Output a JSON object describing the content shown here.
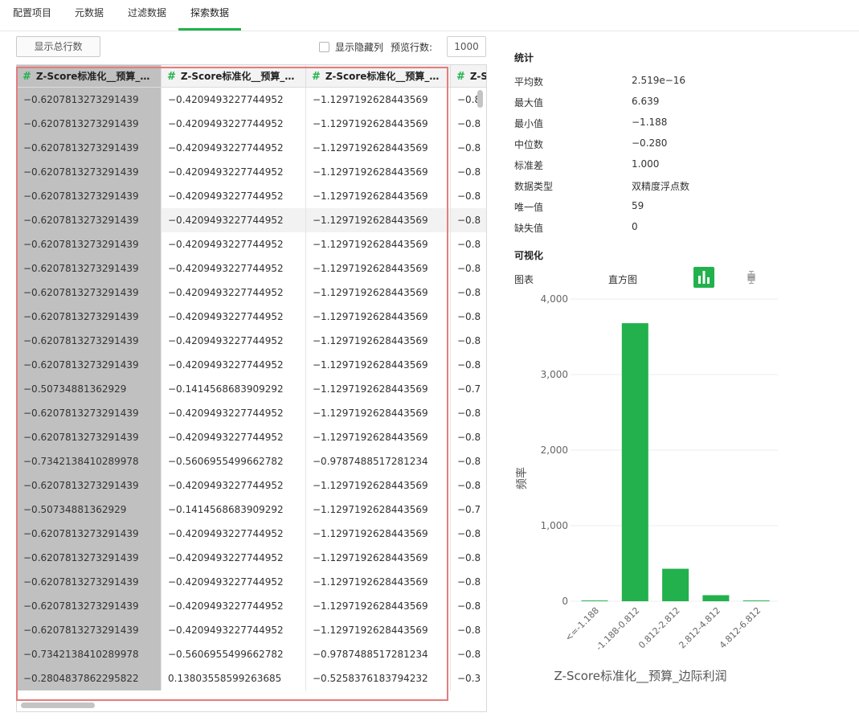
{
  "tabs": [
    {
      "label": "配置项目"
    },
    {
      "label": "元数据"
    },
    {
      "label": "过滤数据"
    },
    {
      "label": "探索数据"
    }
  ],
  "toolbar": {
    "total_rows_button": "显示总行数",
    "show_hidden_label": "显示隐藏列",
    "preview_rows_label": "预览行数:",
    "preview_rows_value": "1000"
  },
  "table": {
    "columns": [
      "Z-Score标准化__预算_…",
      "Z-Score标准化__预算_…",
      "Z-Score标准化__预算_…",
      "Z-S"
    ],
    "rows": [
      [
        "−0.6207813273291439",
        "−0.4209493227744952",
        "−1.1297192628443569",
        "−0.8"
      ],
      [
        "−0.6207813273291439",
        "−0.4209493227744952",
        "−1.1297192628443569",
        "−0.8"
      ],
      [
        "−0.6207813273291439",
        "−0.4209493227744952",
        "−1.1297192628443569",
        "−0.8"
      ],
      [
        "−0.6207813273291439",
        "−0.4209493227744952",
        "−1.1297192628443569",
        "−0.8"
      ],
      [
        "−0.6207813273291439",
        "−0.4209493227744952",
        "−1.1297192628443569",
        "−0.8"
      ],
      [
        "−0.6207813273291439",
        "−0.4209493227744952",
        "−1.1297192628443569",
        "−0.8"
      ],
      [
        "−0.6207813273291439",
        "−0.4209493227744952",
        "−1.1297192628443569",
        "−0.8"
      ],
      [
        "−0.6207813273291439",
        "−0.4209493227744952",
        "−1.1297192628443569",
        "−0.8"
      ],
      [
        "−0.6207813273291439",
        "−0.4209493227744952",
        "−1.1297192628443569",
        "−0.8"
      ],
      [
        "−0.6207813273291439",
        "−0.4209493227744952",
        "−1.1297192628443569",
        "−0.8"
      ],
      [
        "−0.6207813273291439",
        "−0.4209493227744952",
        "−1.1297192628443569",
        "−0.8"
      ],
      [
        "−0.6207813273291439",
        "−0.4209493227744952",
        "−1.1297192628443569",
        "−0.8"
      ],
      [
        "−0.50734881362929",
        "−0.1414568683909292",
        "−1.1297192628443569",
        "−0.7"
      ],
      [
        "−0.6207813273291439",
        "−0.4209493227744952",
        "−1.1297192628443569",
        "−0.8"
      ],
      [
        "−0.6207813273291439",
        "−0.4209493227744952",
        "−1.1297192628443569",
        "−0.8"
      ],
      [
        "−0.7342138410289978",
        "−0.5606955499662782",
        "−0.9787488517281234",
        "−0.8"
      ],
      [
        "−0.6207813273291439",
        "−0.4209493227744952",
        "−1.1297192628443569",
        "−0.8"
      ],
      [
        "−0.50734881362929",
        "−0.1414568683909292",
        "−1.1297192628443569",
        "−0.7"
      ],
      [
        "−0.6207813273291439",
        "−0.4209493227744952",
        "−1.1297192628443569",
        "−0.8"
      ],
      [
        "−0.6207813273291439",
        "−0.4209493227744952",
        "−1.1297192628443569",
        "−0.8"
      ],
      [
        "−0.6207813273291439",
        "−0.4209493227744952",
        "−1.1297192628443569",
        "−0.8"
      ],
      [
        "−0.6207813273291439",
        "−0.4209493227744952",
        "−1.1297192628443569",
        "−0.8"
      ],
      [
        "−0.6207813273291439",
        "−0.4209493227744952",
        "−1.1297192628443569",
        "−0.8"
      ],
      [
        "−0.7342138410289978",
        "−0.5606955499662782",
        "−0.9787488517281234",
        "−0.8"
      ],
      [
        "−0.2804837862295822",
        "0.13803558599263685",
        "−0.5258376183794232",
        "−0.3"
      ]
    ]
  },
  "stats": {
    "title": "统计",
    "items": [
      {
        "label": "平均数",
        "value": "2.519e−16"
      },
      {
        "label": "最大值",
        "value": "6.639"
      },
      {
        "label": "最小值",
        "value": "−1.188"
      },
      {
        "label": "中位数",
        "value": "−0.280"
      },
      {
        "label": "标准差",
        "value": "1.000"
      },
      {
        "label": "数据类型",
        "value": "双精度浮点数"
      },
      {
        "label": "唯一值",
        "value": "59"
      },
      {
        "label": "缺失值",
        "value": "0"
      }
    ]
  },
  "visual": {
    "title": "可视化",
    "chart_label": "图表",
    "chart_type": "直方图",
    "bar_icon": "bar-chart-icon",
    "box_icon": "box-plot-icon"
  },
  "colors": {
    "accent": "#22b14c",
    "selection": "#e47d7d",
    "selected_col": "#c0c0c0"
  },
  "chart_data": {
    "type": "bar",
    "categories": [
      "<=-1.188",
      "-1.188-0.812",
      "0.812-2.812",
      "2.812-4.812",
      "4.812-6.812"
    ],
    "values": [
      10,
      3680,
      430,
      80,
      10
    ],
    "xlabel": "Z-Score标准化__预算_边际利润",
    "ylabel": "频率",
    "ylim": [
      0,
      4000
    ],
    "yticks": [
      "0",
      "1,000",
      "2,000",
      "3,000",
      "4,000"
    ],
    "grid": true
  }
}
